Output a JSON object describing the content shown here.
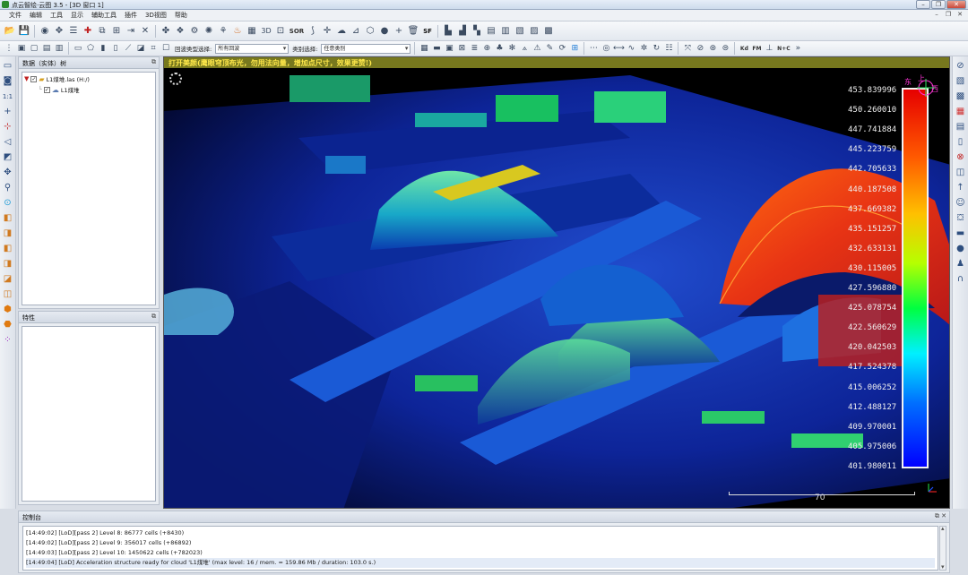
{
  "window": {
    "title": "点云智绘·云图 3.5 - [3D 窗口 1]",
    "controls": [
      "–",
      "❐",
      "✕"
    ]
  },
  "menu": {
    "items": [
      "文件",
      "编辑",
      "工具",
      "显示",
      "辅助工具",
      "插件",
      "3D视图",
      "帮助"
    ],
    "mdi_controls": [
      "–",
      "❐",
      "✕"
    ]
  },
  "toolbar": {
    "sor_label": "SOR",
    "sf_label": "SF",
    "kd_label": "Kd",
    "fm_label": "FM",
    "nc_label": "N+C",
    "echo_type_label": "回波类型选择:",
    "echo_type_value": "所有回波",
    "class_label": "类别选择:",
    "class_value": "任意类别"
  },
  "db_tree": {
    "header": "数据（实体）树",
    "items": [
      {
        "label": "L1煤堆.las (H:/)"
      },
      {
        "label": "L1煤堆"
      }
    ]
  },
  "properties": {
    "header": "特性"
  },
  "viewport": {
    "banner": "打开美颜(鹰眼穹顶布光，勿用法向量，增加点尺寸，效果更赞!)",
    "colorbar": {
      "labels": [
        "453.839996",
        "450.260010",
        "447.741884",
        "445.223759",
        "442.705633",
        "440.187508",
        "437.669382",
        "435.151257",
        "432.633131",
        "430.115005",
        "427.596880",
        "425.078754",
        "422.560629",
        "420.042503",
        "417.524378",
        "415.006252",
        "412.488127",
        "409.970001",
        "405.975006",
        "401.980011"
      ]
    },
    "compass": {
      "east": "东",
      "up": "上",
      "west": "西"
    },
    "scale": {
      "label": "70"
    }
  },
  "console": {
    "header": "控制台",
    "lines": [
      "[14:49:02] [LoD][pass 2] Level 8: 86777 cells (+8430)",
      "[14:49:02] [LoD][pass 2] Level 9: 356017 cells (+86892)",
      "[14:49:03] [LoD][pass 2] Level 10: 1450622 cells (+782023)",
      "[14:49:04] [LoD] Acceleration structure ready for cloud 'L1煤堆' (max level: 16 / mem. = 159.86 Mb / duration: 103.0 s.)"
    ]
  },
  "colors": {
    "banner_bg": "#77781e",
    "banner_text": "#ffe84a",
    "accent": "#2d6cc0"
  }
}
